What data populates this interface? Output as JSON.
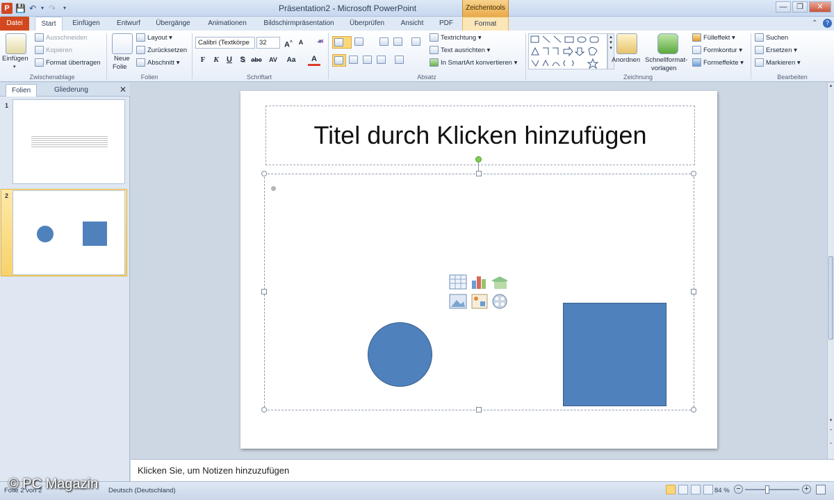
{
  "window": {
    "title": "Präsentation2 - Microsoft PowerPoint",
    "context_tab_title": "Zeichentools",
    "app_icon_letter": "P"
  },
  "tabs": [
    {
      "label": "Datei"
    },
    {
      "label": "Start"
    },
    {
      "label": "Einfügen"
    },
    {
      "label": "Entwurf"
    },
    {
      "label": "Übergänge"
    },
    {
      "label": "Animationen"
    },
    {
      "label": "Bildschirmpräsentation"
    },
    {
      "label": "Überprüfen"
    },
    {
      "label": "Ansicht"
    },
    {
      "label": "PDF"
    },
    {
      "label": "Format"
    }
  ],
  "ribbon": {
    "clipboard": {
      "paste": "Einfügen",
      "cut": "Ausschneiden",
      "copy": "Kopieren",
      "format_painter": "Format übertragen",
      "label": "Zwischenablage"
    },
    "slides": {
      "new_slide_1": "Neue",
      "new_slide_2": "Folie",
      "layout": "Layout",
      "reset": "Zurücksetzen",
      "section": "Abschnitt",
      "label": "Folien"
    },
    "font": {
      "font_name": "Calibri (Textkörpe",
      "font_size": "32",
      "bold": "F",
      "italic": "K",
      "underline": "U",
      "shadow": "S",
      "strike": "abc",
      "spacing": "AV",
      "case": "Aa",
      "color": "A",
      "label": "Schriftart"
    },
    "paragraph": {
      "text_direction": "Textrichtung",
      "align_text": "Text ausrichten",
      "smartart": "In SmartArt konvertieren",
      "label": "Absatz"
    },
    "drawing": {
      "arrange": "Anordnen",
      "quick_styles_1": "Schnellformat-",
      "quick_styles_2": "vorlagen",
      "fill": "Fülleffekt",
      "outline": "Formkontur",
      "effects": "Formeffekte",
      "label": "Zeichnung"
    },
    "editing": {
      "find": "Suchen",
      "replace": "Ersetzen",
      "select": "Markieren",
      "label": "Bearbeiten"
    }
  },
  "left_pane": {
    "tab_slides": "Folien",
    "tab_outline": "Gliederung",
    "slide_numbers": [
      "1",
      "2"
    ]
  },
  "slide": {
    "title_placeholder": "Titel durch Klicken hinzufügen"
  },
  "notes": {
    "placeholder": "Klicken Sie, um Notizen hinzuzufügen"
  },
  "statusbar": {
    "slide_info": "Folie 2 von 2",
    "language": "Deutsch (Deutschland)",
    "zoom": "84 %"
  },
  "watermark": "© PC Magazin",
  "colors": {
    "shape_fill": "#4f81bd",
    "file_tab": "#d2491f",
    "context_tab": "#f0b85a"
  }
}
